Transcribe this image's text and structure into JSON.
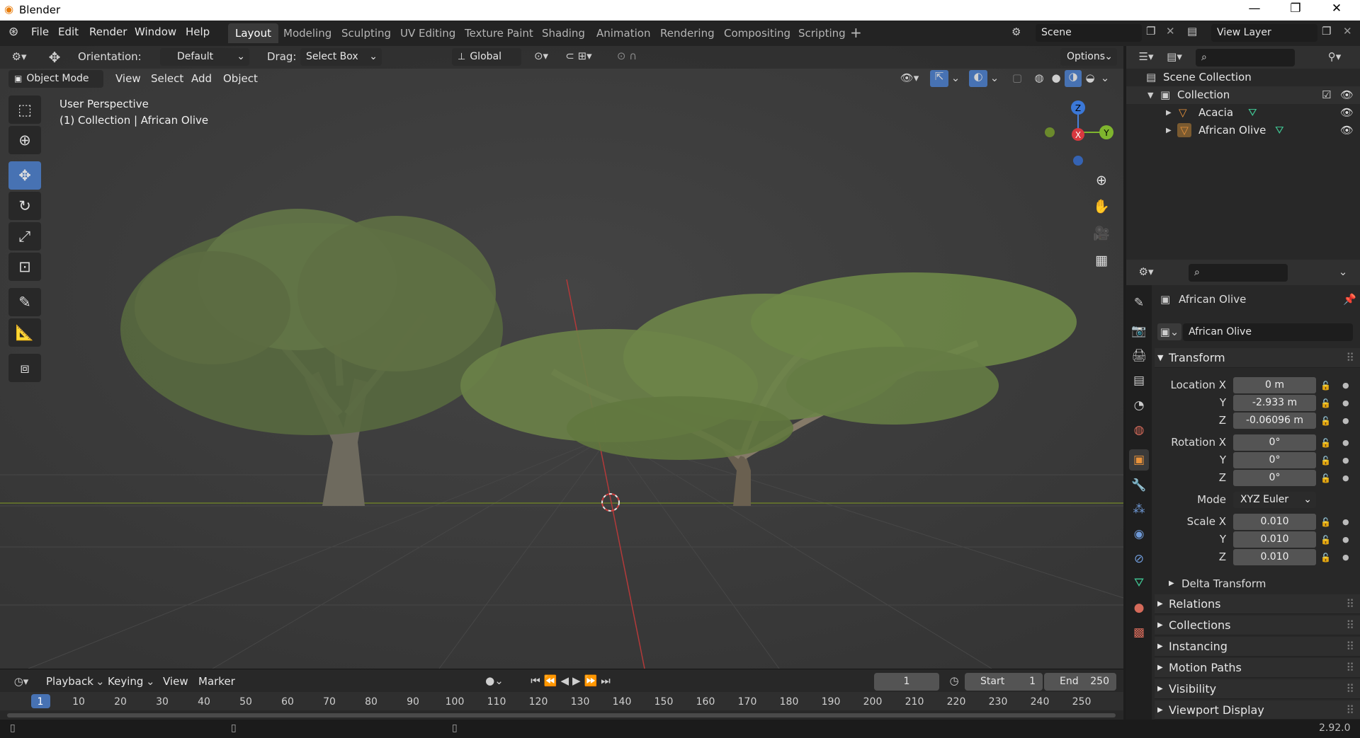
{
  "window": {
    "title": "Blender",
    "minimize": "—",
    "maximize": "❐",
    "close": "✕"
  },
  "menus": [
    "File",
    "Edit",
    "Render",
    "Window",
    "Help"
  ],
  "workspaces": [
    "Layout",
    "Modeling",
    "Sculpting",
    "UV Editing",
    "Texture Paint",
    "Shading",
    "Animation",
    "Rendering",
    "Compositing",
    "Scripting"
  ],
  "scene": {
    "name": "Scene",
    "view_layer": "View Layer"
  },
  "tool_header": {
    "orientation_label": "Orientation:",
    "orientation_value": "Default",
    "drag_label": "Drag:",
    "drag_value": "Select Box",
    "transform_orientation": "Global",
    "options": "Options"
  },
  "viewport_header": {
    "mode": "Object Mode",
    "menus": [
      "View",
      "Select",
      "Add",
      "Object"
    ]
  },
  "viewport": {
    "perspective": "User Perspective",
    "context": "(1) Collection | African Olive"
  },
  "gizmo": {
    "x": "X",
    "y": "Y",
    "z": "Z"
  },
  "outliner": {
    "root": "Scene Collection",
    "collection": "Collection",
    "objects": [
      "Acacia",
      "African Olive"
    ]
  },
  "properties": {
    "object_name": "African Olive",
    "data_name": "African Olive",
    "transform_title": "Transform",
    "location": {
      "label_x": "Location X",
      "x": "0 m",
      "y": "-2.933 m",
      "z": "-0.06096 m"
    },
    "rotation": {
      "label_x": "Rotation X",
      "x": "0°",
      "y": "0°",
      "z": "0°"
    },
    "mode_label": "Mode",
    "mode_value": "XYZ Euler",
    "scale": {
      "label_x": "Scale X",
      "x": "0.010",
      "y": "0.010",
      "z": "0.010"
    },
    "axis_y": "Y",
    "axis_z": "Z",
    "delta_transform": "Delta Transform",
    "sections": [
      "Relations",
      "Collections",
      "Instancing",
      "Motion Paths",
      "Visibility",
      "Viewport Display"
    ]
  },
  "timeline": {
    "menus": [
      "Playback",
      "Keying",
      "View",
      "Marker"
    ],
    "current_frame": "1",
    "start_label": "Start",
    "start": "1",
    "end_label": "End",
    "end": "250",
    "ticks": [
      "1",
      "10",
      "20",
      "30",
      "40",
      "50",
      "60",
      "70",
      "80",
      "90",
      "100",
      "110",
      "120",
      "130",
      "140",
      "150",
      "160",
      "170",
      "180",
      "190",
      "200",
      "210",
      "220",
      "230",
      "240",
      "250"
    ]
  },
  "status": {
    "version": "2.92.0"
  },
  "colors": {
    "accent": "#4772b3",
    "header": "#232323",
    "panel": "#282828",
    "viewport": "#3d3d3d"
  }
}
